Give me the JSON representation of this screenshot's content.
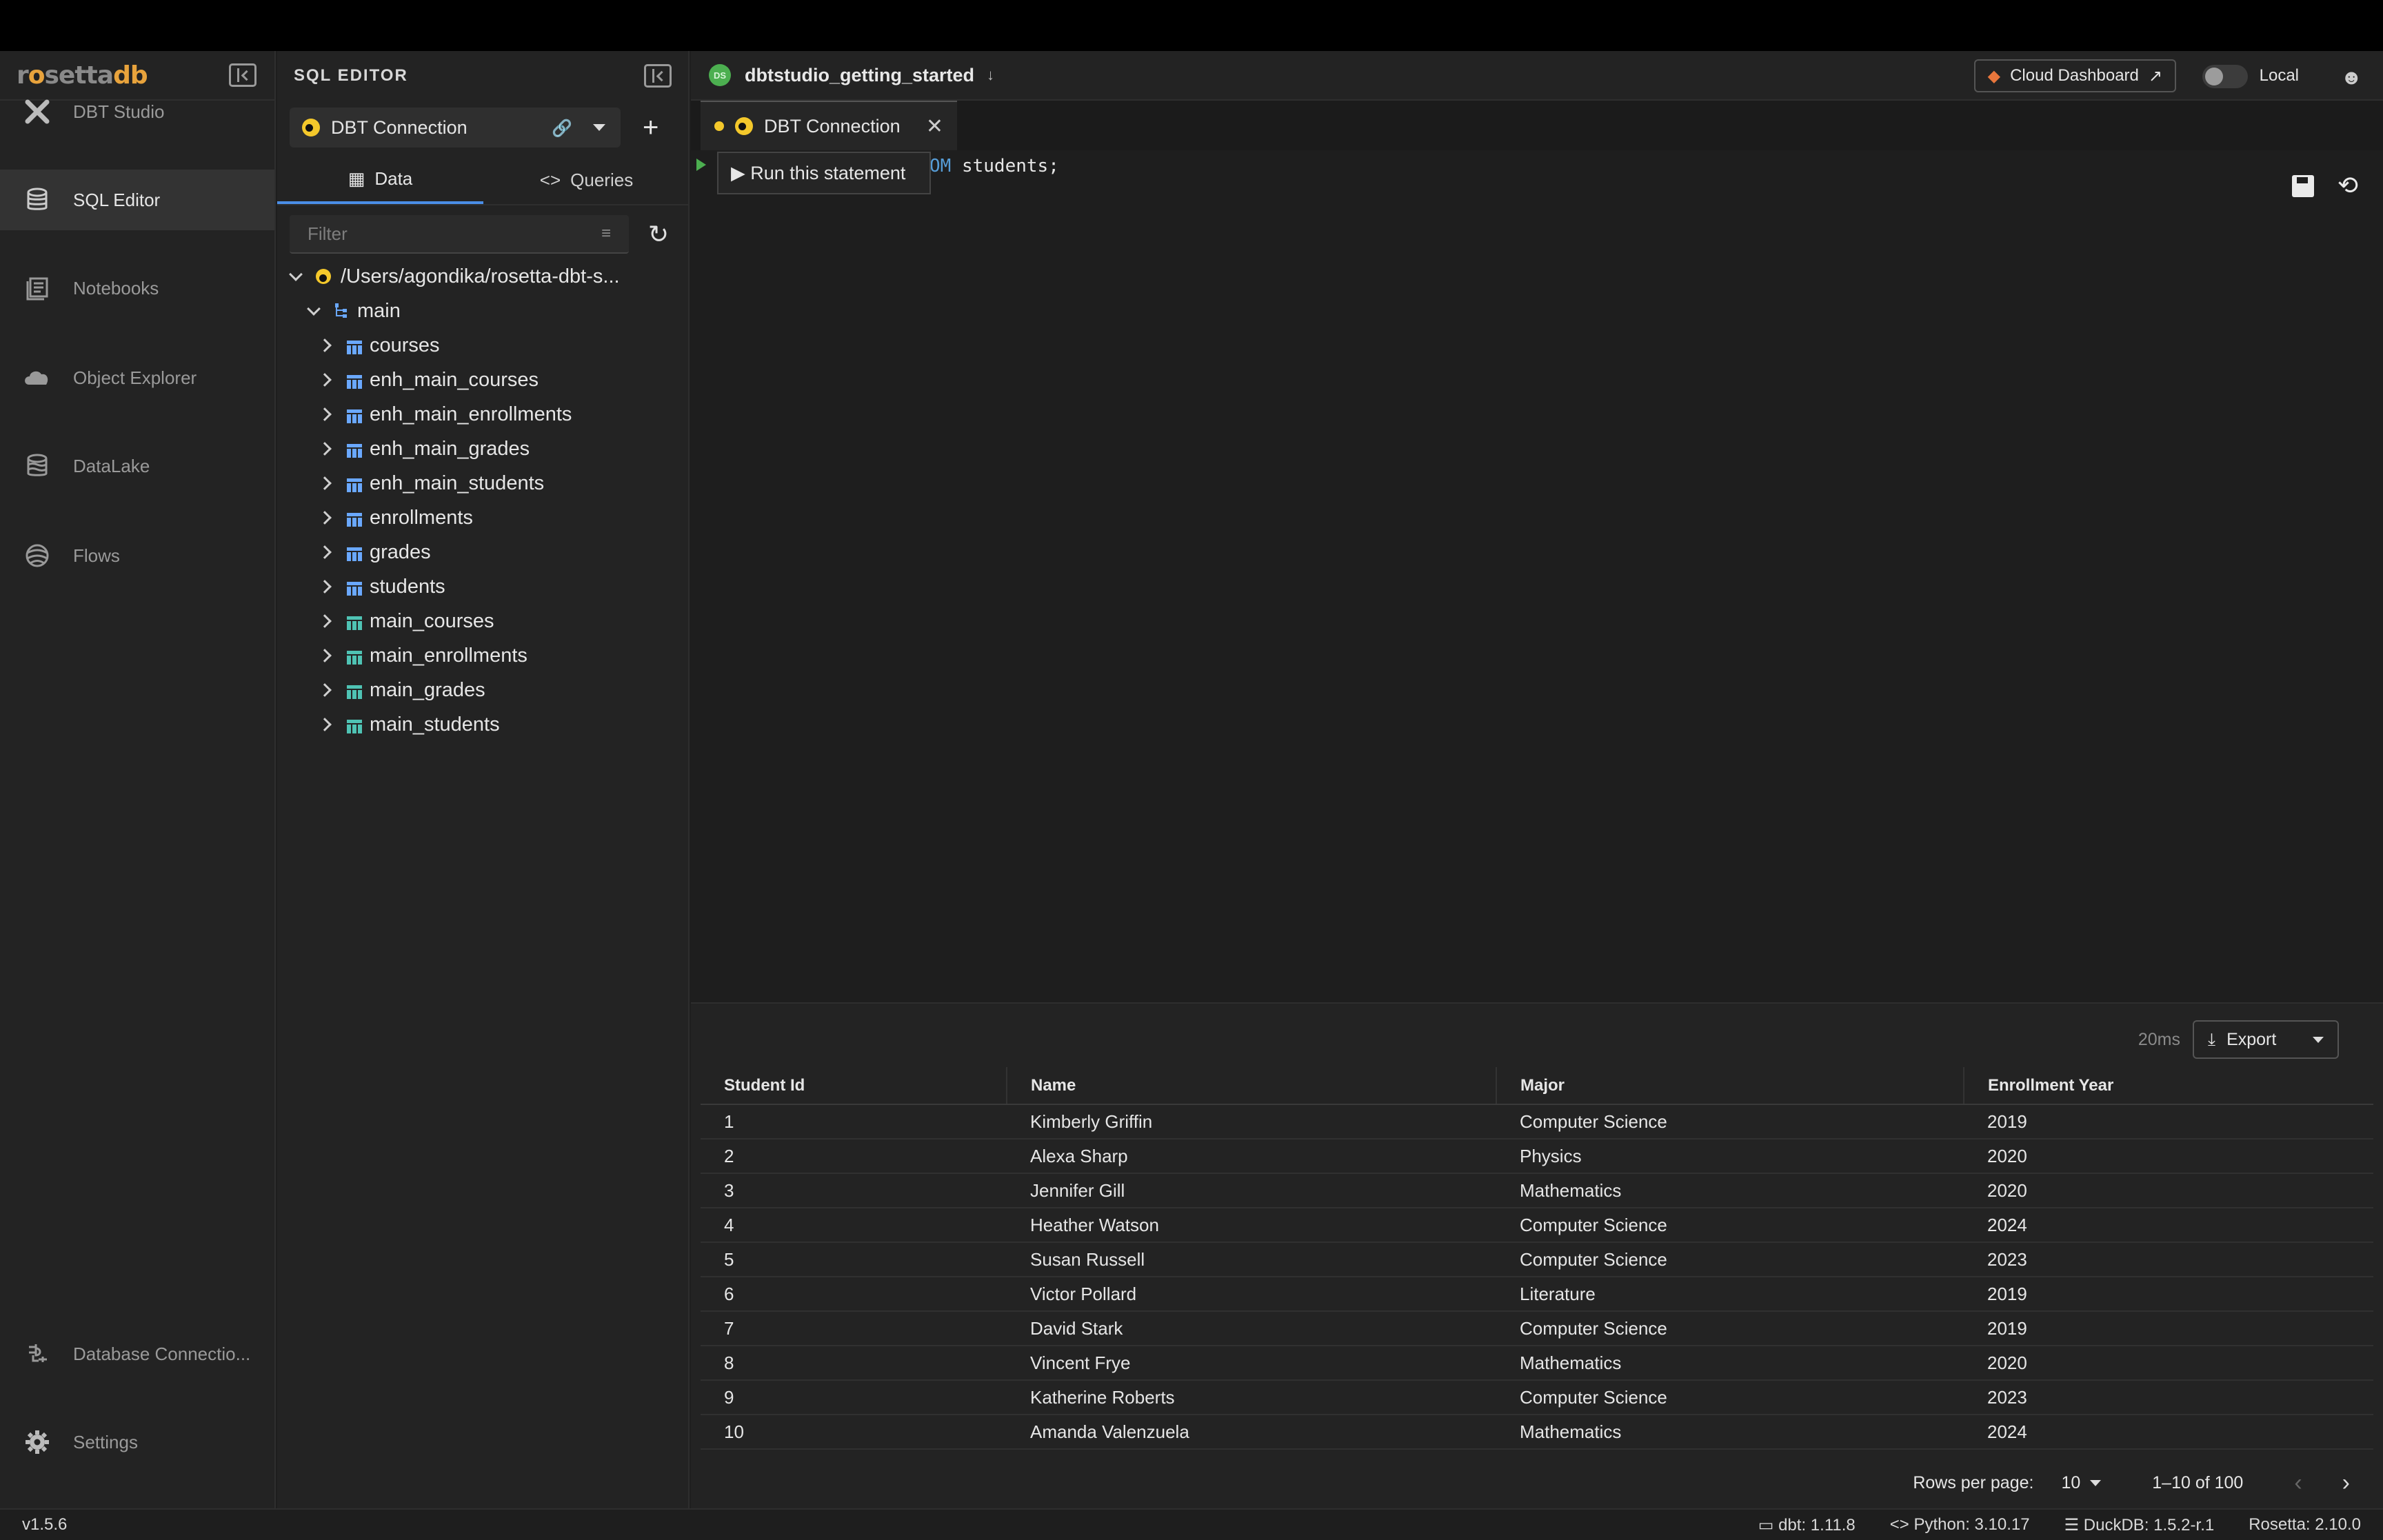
{
  "nav": {
    "logo": {
      "r": "r",
      "o": "o",
      "setta": "setta",
      "db": "db"
    },
    "items": [
      {
        "label": "DBT Studio",
        "icon": "dbt-icon",
        "active": false
      },
      {
        "label": "SQL Editor",
        "icon": "database-icon",
        "active": true
      },
      {
        "label": "Notebooks",
        "icon": "notebook-icon",
        "active": false
      },
      {
        "label": "Object Explorer",
        "icon": "cloud-icon",
        "active": false
      },
      {
        "label": "DataLake",
        "icon": "datalake-icon",
        "active": false
      },
      {
        "label": "Flows",
        "icon": "flows-icon",
        "active": false
      }
    ],
    "bottom": [
      {
        "label": "Database Connectio...",
        "icon": "plug-icon"
      },
      {
        "label": "Settings",
        "icon": "gear-icon"
      }
    ]
  },
  "panel": {
    "title": "SQL EDITOR",
    "connection": "DBT Connection",
    "tabs": [
      "Data",
      "Queries"
    ],
    "filter_placeholder": "Filter",
    "root_path": "/Users/agondika/rosetta-dbt-s...",
    "schema": "main",
    "tables": [
      {
        "name": "courses",
        "color": "#6aa8ff"
      },
      {
        "name": "enh_main_courses",
        "color": "#6aa8ff"
      },
      {
        "name": "enh_main_enrollments",
        "color": "#6aa8ff"
      },
      {
        "name": "enh_main_grades",
        "color": "#6aa8ff"
      },
      {
        "name": "enh_main_students",
        "color": "#6aa8ff"
      },
      {
        "name": "enrollments",
        "color": "#6aa8ff"
      },
      {
        "name": "grades",
        "color": "#6aa8ff"
      },
      {
        "name": "students",
        "color": "#6aa8ff"
      },
      {
        "name": "main_courses",
        "color": "#4fc3b4"
      },
      {
        "name": "main_enrollments",
        "color": "#4fc3b4"
      },
      {
        "name": "main_grades",
        "color": "#4fc3b4"
      },
      {
        "name": "main_students",
        "color": "#4fc3b4"
      }
    ]
  },
  "header": {
    "project_badge": "DS",
    "project_name": "dbtstudio_getting_started",
    "cloud_dashboard": "Cloud Dashboard",
    "mode": "Local"
  },
  "editor": {
    "tab_label": "DBT Connection",
    "code_kw": "OM",
    "code_rest": " students;",
    "tooltip": "▶ Run this statement"
  },
  "results": {
    "timing": "20ms",
    "export_label": "Export",
    "columns": [
      "Student Id",
      "Name",
      "Major",
      "Enrollment Year"
    ],
    "rows": [
      [
        "1",
        "Kimberly Griffin",
        "Computer Science",
        "2019"
      ],
      [
        "2",
        "Alexa Sharp",
        "Physics",
        "2020"
      ],
      [
        "3",
        "Jennifer Gill",
        "Mathematics",
        "2020"
      ],
      [
        "4",
        "Heather Watson",
        "Computer Science",
        "2024"
      ],
      [
        "5",
        "Susan Russell",
        "Computer Science",
        "2023"
      ],
      [
        "6",
        "Victor Pollard",
        "Literature",
        "2019"
      ],
      [
        "7",
        "David Stark",
        "Computer Science",
        "2019"
      ],
      [
        "8",
        "Vincent Frye",
        "Mathematics",
        "2020"
      ],
      [
        "9",
        "Katherine Roberts",
        "Computer Science",
        "2023"
      ],
      [
        "10",
        "Amanda Valenzuela",
        "Mathematics",
        "2024"
      ]
    ],
    "rows_per_page_label": "Rows per page:",
    "rows_per_page": "10",
    "range": "1–10 of 100"
  },
  "status": {
    "version": "v1.5.6",
    "dbt": "dbt: 1.11.8",
    "python": "Python: 3.10.17",
    "duckdb": "DuckDB: 1.5.2-r.1",
    "rosetta": "Rosetta: 2.10.0"
  }
}
